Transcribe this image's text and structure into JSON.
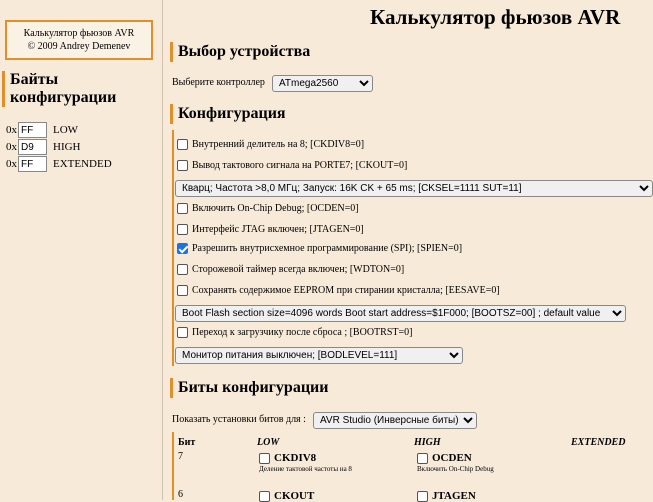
{
  "sidebar": {
    "copyright_line1": "Калькулятор фьюзов AVR",
    "copyright_line2": "© 2009 Andrey Demenev",
    "bytes_title": "Байты конфигурации",
    "hex_prefix": "0x",
    "bytes": [
      {
        "value": "FF",
        "name": "LOW"
      },
      {
        "value": "D9",
        "name": "HIGH"
      },
      {
        "value": "FF",
        "name": "EXTENDED"
      }
    ]
  },
  "header": {
    "title": "Калькулятор фьюзов AVR"
  },
  "device": {
    "section_title": "Выбор устройства",
    "label": "Выберите контроллер",
    "selected": "ATmega2560"
  },
  "config": {
    "section_title": "Конфигурация",
    "options": [
      {
        "label": "Внутренний делитель на 8; [CKDIV8=0]",
        "checked": false
      },
      {
        "label": "Вывод тактового сигнала на PORTE7; [CKOUT=0]",
        "checked": false
      },
      {
        "label": "Включить On-Chip Debug; [OCDEN=0]",
        "checked": false
      },
      {
        "label": "Интерфейс JTAG включен; [JTAGEN=0]",
        "checked": false
      },
      {
        "label": "Разрешить внутрисхемное программирование (SPI); [SPIEN=0]",
        "checked": true
      },
      {
        "label": "Сторожевой таймер всегда включен; [WDTON=0]",
        "checked": false
      },
      {
        "label": "Сохранять содержимое EEPROM при стирании кристалла; [EESAVE=0]",
        "checked": false
      },
      {
        "label": "Переход к загрузчику после сброса ; [BOOTRST=0]",
        "checked": false
      }
    ],
    "clock_select": "Кварц; Частота >8,0 МГц; Запуск: 16K CK + 65 ms; [CKSEL=1111 SUT=11]",
    "boot_select": "Boot Flash section size=4096 words Boot start address=$1F000; [BOOTSZ=00] ; default value",
    "bod_select": "Монитор питания выключен; [BODLEVEL=111]"
  },
  "bits": {
    "section_title": "Биты конфигурации",
    "show_label": "Показать установки битов для :",
    "show_selected": "AVR Studio (Инверсные биты)",
    "col_bit": "Бит",
    "col_low": "LOW",
    "col_high": "HIGH",
    "col_ext": "EXTENDED",
    "rows": [
      {
        "num": "7",
        "low_name": "CKDIV8",
        "low_desc": "Деление тактовой частоты на 8",
        "high_name": "OCDEN",
        "high_desc": "Включить On-Chip Debug"
      },
      {
        "num": "6",
        "low_name": "CKOUT",
        "low_desc": "",
        "high_name": "JTAGEN",
        "high_desc": ""
      }
    ]
  }
}
